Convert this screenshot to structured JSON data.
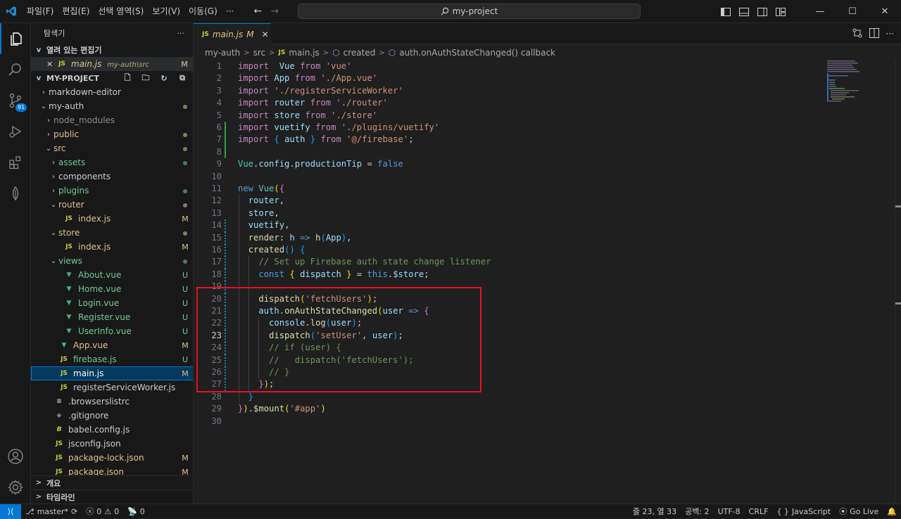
{
  "menu": [
    "파일(F)",
    "편집(E)",
    "선택 영역(S)",
    "보기(V)",
    "이동(G)",
    "···"
  ],
  "command_center": {
    "label": "my-project"
  },
  "activity_bar": {
    "scm_badge": "91"
  },
  "explorer": {
    "title": "탐색기",
    "more": "···",
    "open_editors": {
      "header": "열려 있는 편집기",
      "items": [
        {
          "name": "main.js",
          "path": "my-auth\\src",
          "status": "M"
        }
      ]
    },
    "project": {
      "header": "MY-PROJECT"
    },
    "tree": [
      {
        "name": "markdown-editor",
        "indent": 1,
        "chevron": ">",
        "kind": "folder",
        "status": ""
      },
      {
        "name": "my-auth",
        "indent": 1,
        "chevron": "v",
        "kind": "folder",
        "status": "dot"
      },
      {
        "name": "node_modules",
        "indent": 2,
        "chevron": ">",
        "kind": "folder-dim",
        "status": ""
      },
      {
        "name": "public",
        "indent": 2,
        "chevron": ">",
        "kind": "folder-mod",
        "status": "dot"
      },
      {
        "name": "src",
        "indent": 2,
        "chevron": "v",
        "kind": "folder-mod",
        "status": "dot"
      },
      {
        "name": "assets",
        "indent": 3,
        "chevron": ">",
        "kind": "folder-new",
        "status": "dot-green"
      },
      {
        "name": "components",
        "indent": 3,
        "chevron": ">",
        "kind": "folder",
        "status": ""
      },
      {
        "name": "plugins",
        "indent": 3,
        "chevron": ">",
        "kind": "folder-new",
        "status": "dot-green"
      },
      {
        "name": "router",
        "indent": 3,
        "chevron": "v",
        "kind": "folder-mod",
        "status": "dot"
      },
      {
        "name": "index.js",
        "indent": 4,
        "chevron": "",
        "kind": "js-mod",
        "status": "M"
      },
      {
        "name": "store",
        "indent": 3,
        "chevron": "v",
        "kind": "folder-mod",
        "status": "dot"
      },
      {
        "name": "index.js",
        "indent": 4,
        "chevron": "",
        "kind": "js-mod",
        "status": "M"
      },
      {
        "name": "views",
        "indent": 3,
        "chevron": "v",
        "kind": "folder-new",
        "status": "dot-green"
      },
      {
        "name": "About.vue",
        "indent": 4,
        "chevron": "",
        "kind": "vue-new",
        "status": "U"
      },
      {
        "name": "Home.vue",
        "indent": 4,
        "chevron": "",
        "kind": "vue-new",
        "status": "U"
      },
      {
        "name": "Login.vue",
        "indent": 4,
        "chevron": "",
        "kind": "vue-new",
        "status": "U"
      },
      {
        "name": "Register.vue",
        "indent": 4,
        "chevron": "",
        "kind": "vue-new",
        "status": "U"
      },
      {
        "name": "UserInfo.vue",
        "indent": 4,
        "chevron": "",
        "kind": "vue-new",
        "status": "U"
      },
      {
        "name": "App.vue",
        "indent": 3,
        "chevron": "",
        "kind": "vue-mod",
        "status": "M"
      },
      {
        "name": "firebase.js",
        "indent": 3,
        "chevron": "",
        "kind": "js-new",
        "status": "U"
      },
      {
        "name": "main.js",
        "indent": 3,
        "chevron": "",
        "kind": "js-mod",
        "status": "M",
        "selected": true
      },
      {
        "name": "registerServiceWorker.js",
        "indent": 3,
        "chevron": "",
        "kind": "js",
        "status": ""
      },
      {
        "name": ".browserslistrc",
        "indent": 2,
        "chevron": "",
        "kind": "lines",
        "status": ""
      },
      {
        "name": ".gitignore",
        "indent": 2,
        "chevron": "",
        "kind": "git",
        "status": ""
      },
      {
        "name": "babel.config.js",
        "indent": 2,
        "chevron": "",
        "kind": "babel",
        "status": ""
      },
      {
        "name": "jsconfig.json",
        "indent": 2,
        "chevron": "",
        "kind": "json",
        "status": ""
      },
      {
        "name": "package-lock.json",
        "indent": 2,
        "chevron": "",
        "kind": "json-mod",
        "status": "M"
      },
      {
        "name": "package.json",
        "indent": 2,
        "chevron": "",
        "kind": "json-mod",
        "status": "M"
      }
    ],
    "outline": "개요",
    "timeline": "타임라인"
  },
  "tab": {
    "icon": "JS",
    "name": "main.js",
    "status": "M",
    "close": "✕"
  },
  "breadcrumbs": [
    "my-auth",
    "src",
    "main.js",
    "created",
    "auth.onAuthStateChanged() callback"
  ],
  "colors": {
    "accent": "#0078d4",
    "modified": "#e2c08d",
    "untracked": "#73c991",
    "highlight_box": "#e81123"
  },
  "editor": {
    "current_line": 23,
    "lines": [
      [
        [
          "kw2",
          "import"
        ],
        [
          "",
          "  "
        ],
        [
          "var",
          "Vue"
        ],
        [
          "",
          " "
        ],
        [
          "kw2",
          "from"
        ],
        [
          "",
          " "
        ],
        [
          "str",
          "'vue'"
        ]
      ],
      [
        [
          "kw2",
          "import"
        ],
        [
          "",
          " "
        ],
        [
          "var",
          "App"
        ],
        [
          "",
          " "
        ],
        [
          "kw2",
          "from"
        ],
        [
          "",
          " "
        ],
        [
          "str",
          "'./App.vue'"
        ]
      ],
      [
        [
          "kw2",
          "import"
        ],
        [
          "",
          " "
        ],
        [
          "str",
          "'./registerServiceWorker'"
        ]
      ],
      [
        [
          "kw2",
          "import"
        ],
        [
          "",
          " "
        ],
        [
          "var",
          "router"
        ],
        [
          "",
          " "
        ],
        [
          "kw2",
          "from"
        ],
        [
          "",
          " "
        ],
        [
          "str",
          "'./router'"
        ]
      ],
      [
        [
          "kw2",
          "import"
        ],
        [
          "",
          " "
        ],
        [
          "var",
          "store"
        ],
        [
          "",
          " "
        ],
        [
          "kw2",
          "from"
        ],
        [
          "",
          " "
        ],
        [
          "str",
          "'./store'"
        ]
      ],
      [
        [
          "kw2",
          "import"
        ],
        [
          "",
          " "
        ],
        [
          "var",
          "vuetify"
        ],
        [
          "",
          " "
        ],
        [
          "kw2",
          "from"
        ],
        [
          "",
          " "
        ],
        [
          "str",
          "'./plugins/vuetify'"
        ]
      ],
      [
        [
          "kw2",
          "import"
        ],
        [
          "",
          " "
        ],
        [
          "br3",
          "{"
        ],
        [
          "",
          " "
        ],
        [
          "var",
          "auth"
        ],
        [
          "",
          " "
        ],
        [
          "br3",
          "}"
        ],
        [
          "",
          " "
        ],
        [
          "kw2",
          "from"
        ],
        [
          "",
          " "
        ],
        [
          "str",
          "'@/firebase'"
        ],
        [
          "",
          ";"
        ]
      ],
      [],
      [
        [
          "cls",
          "Vue"
        ],
        [
          "",
          "."
        ],
        [
          "var",
          "config"
        ],
        [
          "",
          "."
        ],
        [
          "var",
          "productionTip"
        ],
        [
          "",
          " = "
        ],
        [
          "kw",
          "false"
        ]
      ],
      [],
      [
        [
          "kw",
          "new"
        ],
        [
          "",
          " "
        ],
        [
          "cls",
          "Vue"
        ],
        [
          "br1",
          "("
        ],
        [
          "br2",
          "{"
        ]
      ],
      [
        [
          "",
          "  "
        ],
        [
          "var",
          "router"
        ],
        [
          "",
          ","
        ]
      ],
      [
        [
          "",
          "  "
        ],
        [
          "var",
          "store"
        ],
        [
          "",
          ","
        ]
      ],
      [
        [
          "",
          "  "
        ],
        [
          "var",
          "vuetify"
        ],
        [
          "",
          ","
        ]
      ],
      [
        [
          "",
          "  "
        ],
        [
          "fn",
          "render"
        ],
        [
          "",
          ": "
        ],
        [
          "var",
          "h"
        ],
        [
          "",
          " "
        ],
        [
          "kw",
          "=>"
        ],
        [
          "",
          " "
        ],
        [
          "fn",
          "h"
        ],
        [
          "br3",
          "("
        ],
        [
          "var",
          "App"
        ],
        [
          "br3",
          ")"
        ],
        [
          "",
          ","
        ]
      ],
      [
        [
          "",
          "  "
        ],
        [
          "fn",
          "created"
        ],
        [
          "br3",
          "()"
        ],
        [
          "",
          " "
        ],
        [
          "br3",
          "{"
        ]
      ],
      [
        [
          "",
          "    "
        ],
        [
          "cmt",
          "// Set up Firebase auth state change listener"
        ]
      ],
      [
        [
          "",
          "    "
        ],
        [
          "kw",
          "const"
        ],
        [
          "",
          " "
        ],
        [
          "br1",
          "{"
        ],
        [
          "",
          " "
        ],
        [
          "var",
          "dispatch"
        ],
        [
          "",
          " "
        ],
        [
          "br1",
          "}"
        ],
        [
          "",
          " = "
        ],
        [
          "kw",
          "this"
        ],
        [
          "",
          "."
        ],
        [
          "var",
          "$store"
        ],
        [
          "",
          ";"
        ]
      ],
      [],
      [
        [
          "",
          "    "
        ],
        [
          "fn",
          "dispatch"
        ],
        [
          "br1",
          "("
        ],
        [
          "str",
          "'fetchUsers'"
        ],
        [
          "br1",
          ")"
        ],
        [
          "",
          ";"
        ]
      ],
      [
        [
          "",
          "    "
        ],
        [
          "var",
          "auth"
        ],
        [
          "",
          "."
        ],
        [
          "fn",
          "onAuthStateChanged"
        ],
        [
          "br1",
          "("
        ],
        [
          "var",
          "user"
        ],
        [
          "",
          " "
        ],
        [
          "kw",
          "=>"
        ],
        [
          "",
          " "
        ],
        [
          "br2",
          "{"
        ]
      ],
      [
        [
          "",
          "      "
        ],
        [
          "var",
          "console"
        ],
        [
          "",
          "."
        ],
        [
          "fn",
          "log"
        ],
        [
          "br3",
          "("
        ],
        [
          "var",
          "user"
        ],
        [
          "br3",
          ")"
        ],
        [
          "",
          ";"
        ]
      ],
      [
        [
          "",
          "      "
        ],
        [
          "fn",
          "dispatch"
        ],
        [
          "br3",
          "("
        ],
        [
          "str",
          "'setUser'"
        ],
        [
          "",
          ", "
        ],
        [
          "var",
          "user"
        ],
        [
          "br3",
          ")"
        ],
        [
          "",
          ";"
        ]
      ],
      [
        [
          "",
          "      "
        ],
        [
          "cmt",
          "// if (user) {"
        ]
      ],
      [
        [
          "",
          "      "
        ],
        [
          "cmt",
          "//   dispatch('fetchUsers');"
        ]
      ],
      [
        [
          "",
          "      "
        ],
        [
          "cmt",
          "// }"
        ]
      ],
      [
        [
          "",
          "    "
        ],
        [
          "br2",
          "}"
        ],
        [
          "br1",
          ")"
        ],
        [
          "",
          ";"
        ]
      ],
      [
        [
          "",
          "  "
        ],
        [
          "br3",
          "}"
        ]
      ],
      [
        [
          "br2",
          "}"
        ],
        [
          "br1",
          ")"
        ],
        [
          "",
          "."
        ],
        [
          "fn",
          "$mount"
        ],
        [
          "br1",
          "("
        ],
        [
          "str",
          "'#app'"
        ],
        [
          "br1",
          ")"
        ]
      ],
      []
    ]
  },
  "status": {
    "branch": "master*",
    "errors": "0",
    "warnings": "0",
    "ports": "0",
    "position": "줄 23, 열 33",
    "spaces": "공백: 2",
    "encoding": "UTF-8",
    "eol": "CRLF",
    "language": "JavaScript",
    "golive": "Go Live"
  }
}
